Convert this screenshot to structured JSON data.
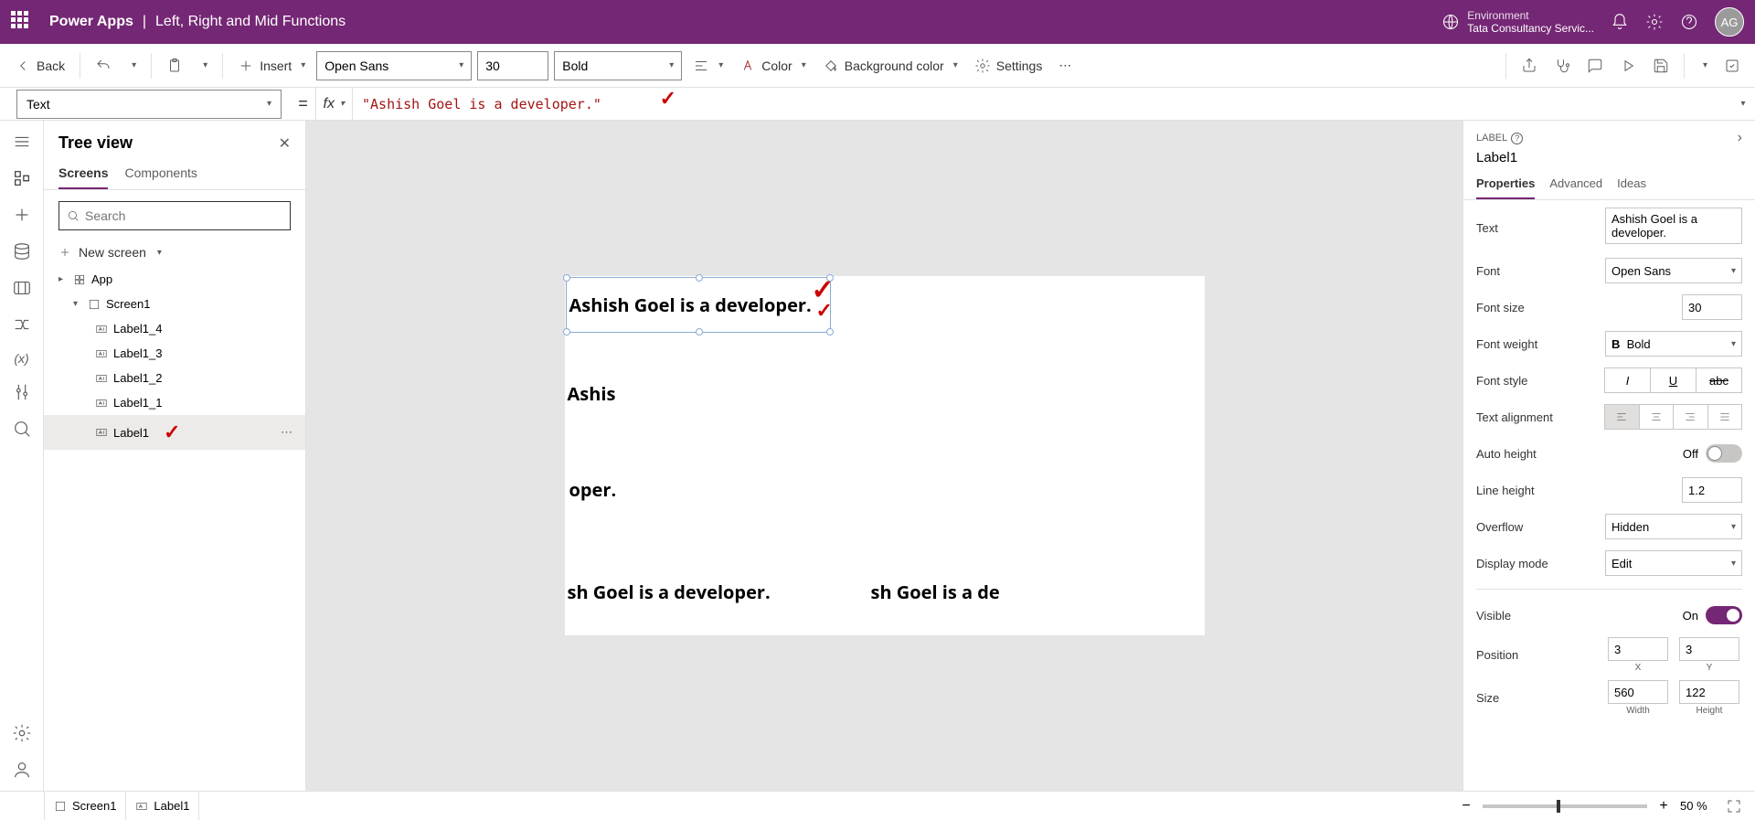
{
  "header": {
    "app": "Power Apps",
    "subtitle": "Left, Right and Mid Functions",
    "env_label": "Environment",
    "env_name": "Tata Consultancy Servic...",
    "avatar": "AG"
  },
  "toolbar": {
    "back": "Back",
    "insert": "Insert",
    "font": "Open Sans",
    "size": "30",
    "weight": "Bold",
    "color": "Color",
    "bgcolor": "Background color",
    "settings": "Settings"
  },
  "formula": {
    "property": "Text",
    "value": "\"Ashish Goel is a developer.\""
  },
  "tree": {
    "title": "Tree view",
    "tabs": {
      "screens": "Screens",
      "components": "Components"
    },
    "search_ph": "Search",
    "new_screen": "New screen",
    "items": {
      "app": "App",
      "screen1": "Screen1",
      "l14": "Label1_4",
      "l13": "Label1_3",
      "l12": "Label1_2",
      "l11": "Label1_1",
      "l1": "Label1"
    }
  },
  "canvas": {
    "label1": "Ashish Goel is a developer.",
    "label2": "Ashis",
    "label3": "oper.",
    "label4": "sh Goel is a developer.",
    "label5": "sh Goel is a de"
  },
  "rpanel": {
    "type": "LABEL",
    "name": "Label1",
    "tabs": {
      "props": "Properties",
      "adv": "Advanced",
      "ideas": "Ideas"
    },
    "text_l": "Text",
    "text_v": "Ashish Goel is a developer.",
    "font_l": "Font",
    "font_v": "Open Sans",
    "fontsize_l": "Font size",
    "fontsize_v": "30",
    "fontweight_l": "Font weight",
    "fontweight_v": "Bold",
    "fontstyle_l": "Font style",
    "align_l": "Text alignment",
    "autoh_l": "Auto height",
    "autoh_v": "Off",
    "lineh_l": "Line height",
    "lineh_v": "1.2",
    "overflow_l": "Overflow",
    "overflow_v": "Hidden",
    "dispmode_l": "Display mode",
    "dispmode_v": "Edit",
    "visible_l": "Visible",
    "visible_v": "On",
    "pos_l": "Position",
    "pos_x": "3",
    "pos_y": "3",
    "pos_xl": "X",
    "pos_yl": "Y",
    "size_l": "Size",
    "size_w": "560",
    "size_h": "122",
    "size_wl": "Width",
    "size_hl": "Height"
  },
  "bottom": {
    "screen": "Screen1",
    "label": "Label1",
    "zoom": "50  %"
  }
}
